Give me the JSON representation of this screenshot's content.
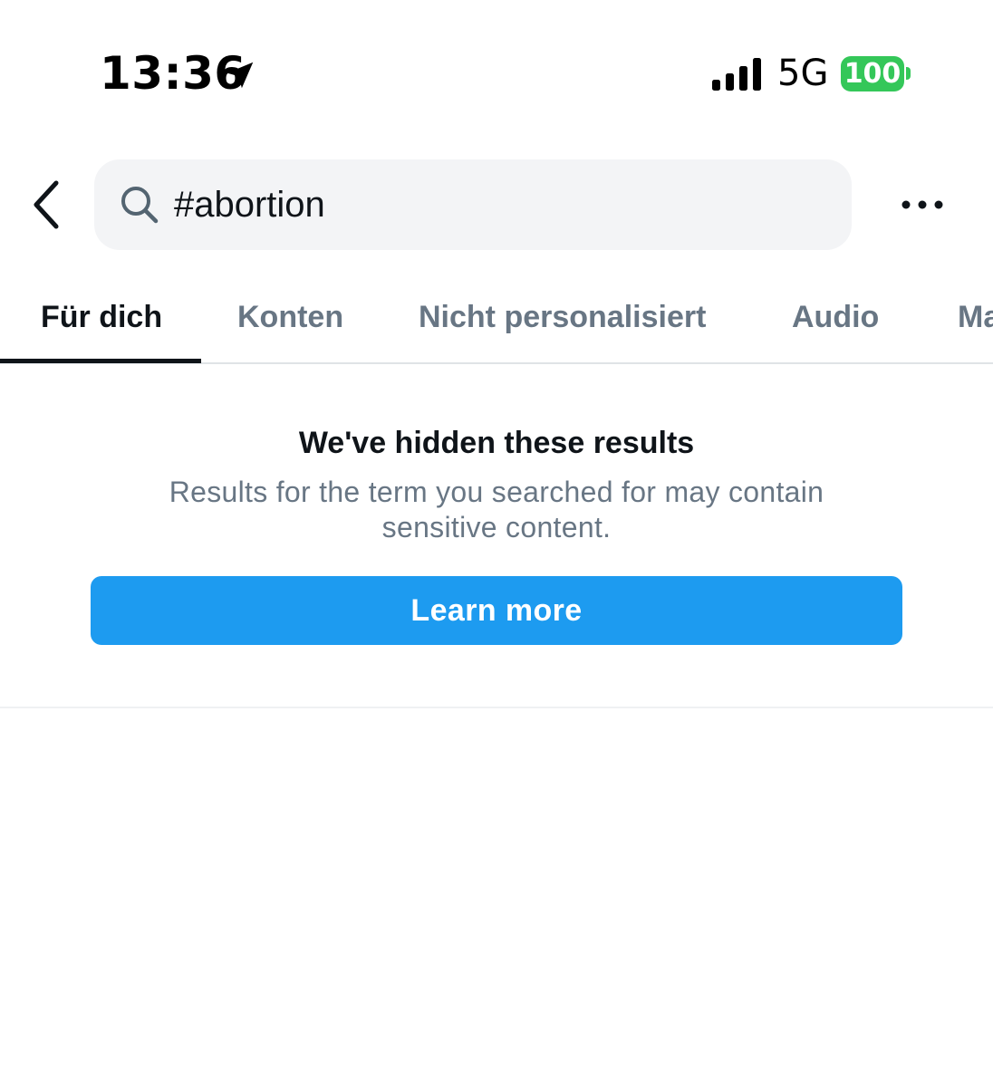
{
  "status_bar": {
    "time": "13:36",
    "network": "5G",
    "battery": "100",
    "icons": [
      "location-arrow-icon",
      "signal-bars-icon"
    ],
    "battery_color": "#34c759"
  },
  "header": {
    "back_icon": "chevron-left-icon",
    "search": {
      "value": "#abortion",
      "icon": "search-icon"
    },
    "more_icon": "more-horizontal-icon"
  },
  "tabs": [
    {
      "label": "Für dich",
      "active": true
    },
    {
      "label": "Konten",
      "active": false
    },
    {
      "label": "Nicht personalisiert",
      "active": false
    },
    {
      "label": "Audio",
      "active": false
    },
    {
      "label": "Ma",
      "active": false
    }
  ],
  "notice": {
    "title": "We've hidden these results",
    "body": "Results for the term you searched for may contain sensitive content.",
    "button_label": "Learn more"
  },
  "colors": {
    "accent": "#1d9bf0",
    "text_primary": "#0f1419",
    "text_secondary": "#687684",
    "search_background": "#f3f4f6"
  }
}
